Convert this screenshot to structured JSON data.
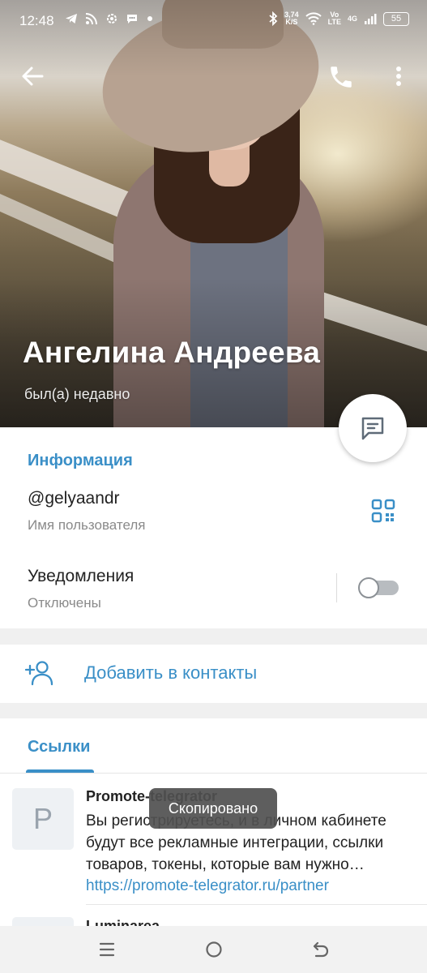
{
  "status_bar": {
    "time": "12:48",
    "net_speed_value": "3,74",
    "net_speed_unit": "K/S",
    "volte_top": "Vo",
    "volte_bottom": "LTE",
    "network": "4G",
    "battery": "55"
  },
  "profile": {
    "name": "Ангелина Андреева",
    "last_seen": "был(а) недавно"
  },
  "info": {
    "section_title": "Информация",
    "username": "@gelyaandr",
    "username_caption": "Имя пользователя",
    "notifications_label": "Уведомления",
    "notifications_status": "Отключены",
    "notifications_enabled": false
  },
  "actions": {
    "add_contact": "Добавить в контакты"
  },
  "links": {
    "section_title": "Ссылки",
    "items": [
      {
        "thumb_letter": "P",
        "title": "Promote-telegrator",
        "description": "Вы регистрируетесь, и в личном кабинете будут все рекламные интеграции, ссылки товаров, токены, которые вам нужно…",
        "url": "https://promote-telegrator.ru/partner"
      },
      {
        "title": "Luminarea"
      }
    ]
  },
  "toast": "Скопировано",
  "colors": {
    "accent": "#3a8fc7",
    "text": "#222222",
    "secondary": "#8a8a8a"
  },
  "icons": [
    "back-arrow-icon",
    "phone-icon",
    "more-vert-icon",
    "message-icon",
    "qr-code-icon",
    "add-person-icon",
    "menu-icon",
    "home-icon",
    "back-icon"
  ]
}
